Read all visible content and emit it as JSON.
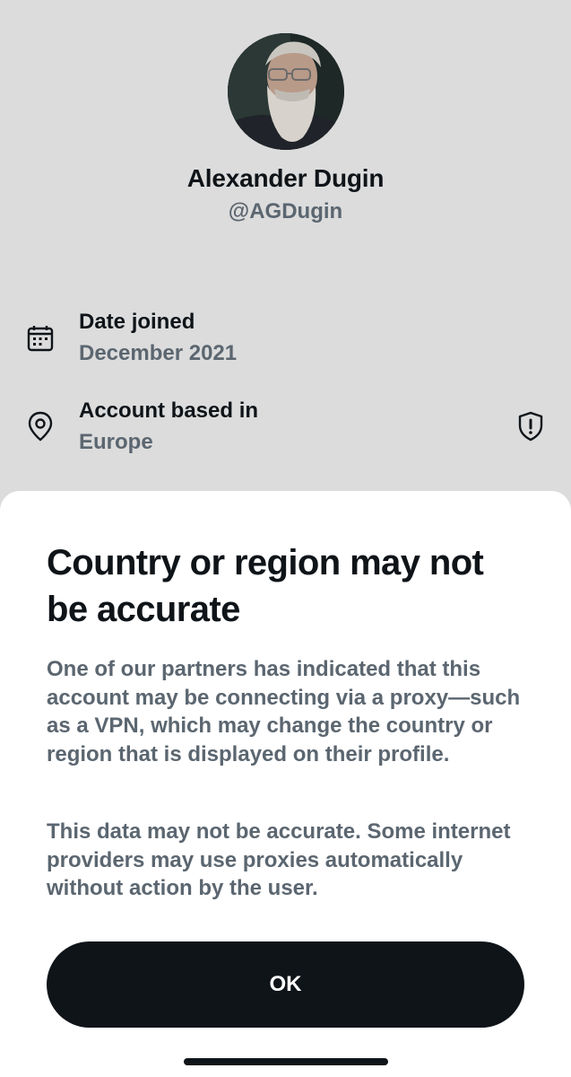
{
  "profile": {
    "name": "Alexander Dugin",
    "handle": "@AGDugin",
    "avatar_icon": "profile-photo"
  },
  "details": [
    {
      "icon": "calendar-icon",
      "label": "Date joined",
      "value": "December 2021"
    },
    {
      "icon": "location-pin-icon",
      "label": "Account based in",
      "value": "Europe",
      "badge_icon": "shield-alert-icon"
    }
  ],
  "sheet": {
    "title": "Country or region may not be accurate",
    "paragraph_1": "One of our partners has indicated that this account may be connecting via a proxy—such as a VPN, which may change the country or region that is displayed on their profile.",
    "paragraph_2": "This data may not be accurate. Some internet providers may use proxies automatically without action by the user.",
    "ok_label": "OK"
  },
  "colors": {
    "background": "#dcdcdc",
    "sheet": "#ffffff",
    "primary_text": "#0f1419",
    "secondary_text": "#5b6670",
    "button": "#0f1419"
  }
}
